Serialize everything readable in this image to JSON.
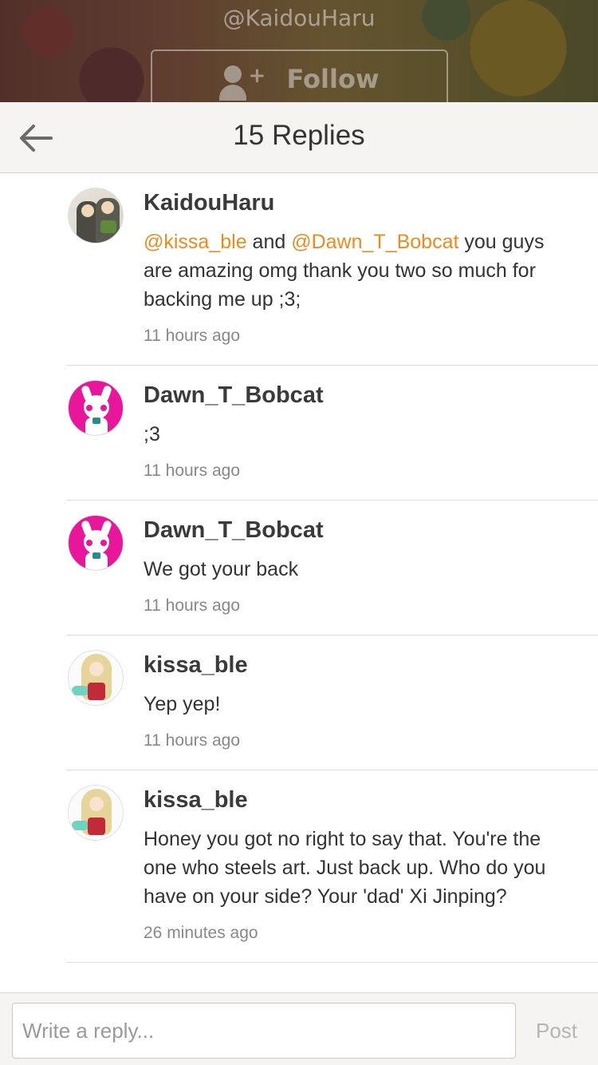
{
  "background": {
    "username": "@KaidouHaru",
    "follow_label": "Follow"
  },
  "header": {
    "title": "15 Replies",
    "back_icon": "back-arrow-icon"
  },
  "replies": [
    {
      "author": "KaidouHaru",
      "segments": [
        {
          "text": "@kissa_ble",
          "mention": true
        },
        {
          "text": " and ",
          "mention": false
        },
        {
          "text": "@Dawn_T_Bobcat",
          "mention": true
        },
        {
          "text": " you guys are amazing omg thank you two so much for backing me up ;3;",
          "mention": false
        }
      ],
      "time": "11 hours ago",
      "avatar": "kaidou"
    },
    {
      "author": "Dawn_T_Bobcat",
      "segments": [
        {
          "text": ";3",
          "mention": false
        }
      ],
      "time": "11 hours ago",
      "avatar": "dawn"
    },
    {
      "author": "Dawn_T_Bobcat",
      "segments": [
        {
          "text": "We got your back",
          "mention": false
        }
      ],
      "time": "11 hours ago",
      "avatar": "dawn"
    },
    {
      "author": "kissa_ble",
      "segments": [
        {
          "text": "Yep yep!",
          "mention": false
        }
      ],
      "time": "11 hours ago",
      "avatar": "kissa"
    },
    {
      "author": "kissa_ble",
      "segments": [
        {
          "text": "Honey you got no right to say that. You're the one who steels art. Just back up. Who do you have on your side? Your 'dad' Xi Jinping?",
          "mention": false
        }
      ],
      "time": "26 minutes ago",
      "avatar": "kissa"
    }
  ],
  "composer": {
    "placeholder": "Write a reply...",
    "post_label": "Post"
  },
  "colors": {
    "mention": "#f08a1c",
    "topbar_bg": "#f5f4f2",
    "dawn_avatar": "#e8169a"
  }
}
